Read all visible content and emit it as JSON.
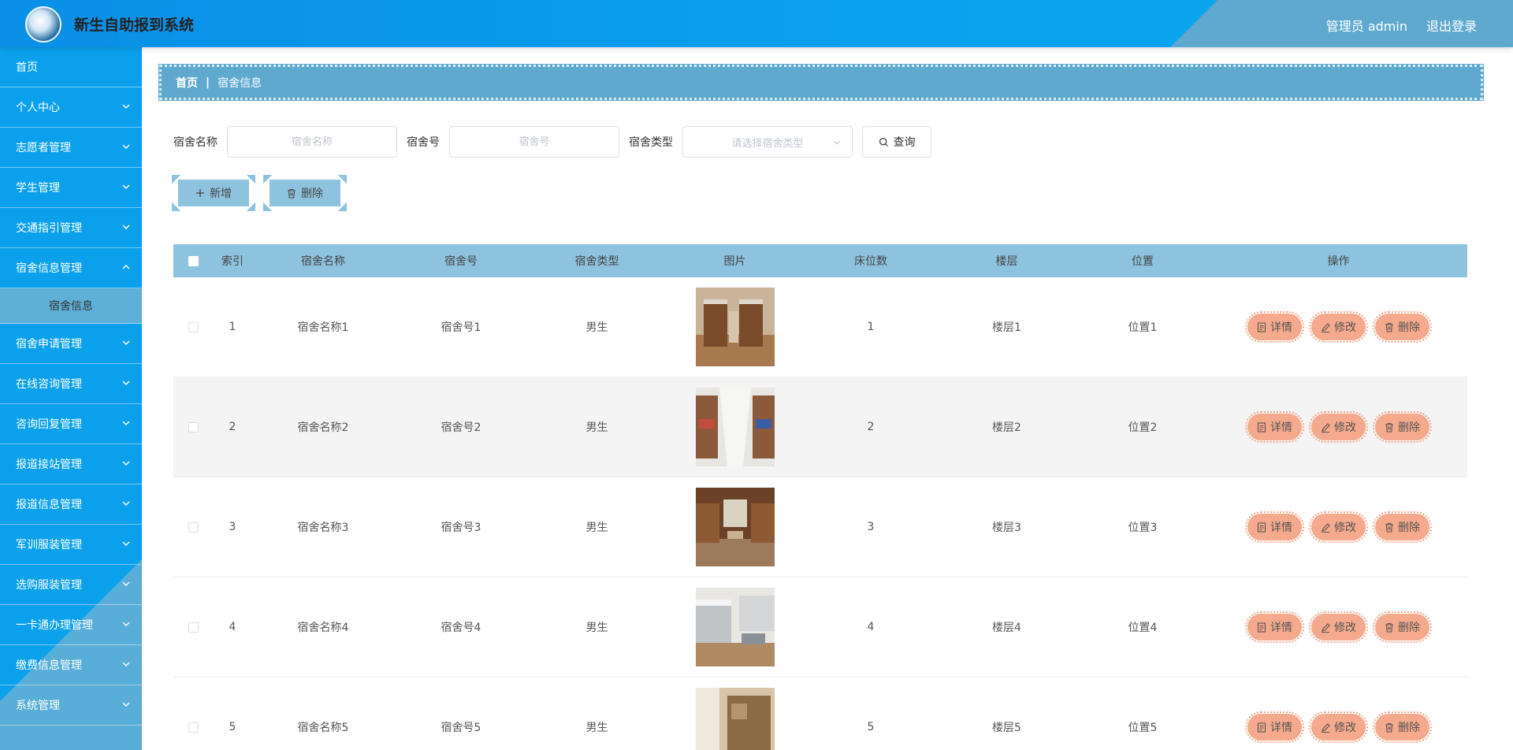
{
  "header": {
    "title": "新生自助报到系统",
    "admin_label": "管理员 admin",
    "logout_label": "退出登录"
  },
  "sidebar": {
    "items": [
      {
        "label": "首页"
      },
      {
        "label": "个人中心"
      },
      {
        "label": "志愿者管理"
      },
      {
        "label": "学生管理"
      },
      {
        "label": "交通指引管理"
      },
      {
        "label": "宿舍信息管理"
      },
      {
        "label": "宿舍信息"
      },
      {
        "label": "宿舍申请管理"
      },
      {
        "label": "在线咨询管理"
      },
      {
        "label": "咨询回复管理"
      },
      {
        "label": "报道接站管理"
      },
      {
        "label": "报道信息管理"
      },
      {
        "label": "军训服装管理"
      },
      {
        "label": "选购服装管理"
      },
      {
        "label": "一卡通办理管理"
      },
      {
        "label": "缴费信息管理"
      },
      {
        "label": "系统管理"
      }
    ]
  },
  "breadcrumb": {
    "home": "首页",
    "current": "宿舍信息"
  },
  "search": {
    "name_label": "宿舍名称",
    "name_placeholder": "宿舍名称",
    "no_label": "宿舍号",
    "no_placeholder": "宿舍号",
    "type_label": "宿舍类型",
    "type_placeholder": "请选择宿舍类型",
    "query_label": "查询"
  },
  "actions": {
    "add_label": "新增",
    "delete_label": "删除"
  },
  "table": {
    "headers": [
      "索引",
      "宿舍名称",
      "宿舍号",
      "宿舍类型",
      "图片",
      "床位数",
      "楼层",
      "位置",
      "操作"
    ],
    "rows": [
      {
        "idx": "1",
        "name": "宿舍名称1",
        "no": "宿舍号1",
        "type": "男生",
        "bed": "1",
        "floor": "楼层1",
        "pos": "位置1"
      },
      {
        "idx": "2",
        "name": "宿舍名称2",
        "no": "宿舍号2",
        "type": "男生",
        "bed": "2",
        "floor": "楼层2",
        "pos": "位置2"
      },
      {
        "idx": "3",
        "name": "宿舍名称3",
        "no": "宿舍号3",
        "type": "男生",
        "bed": "3",
        "floor": "楼层3",
        "pos": "位置3"
      },
      {
        "idx": "4",
        "name": "宿舍名称4",
        "no": "宿舍号4",
        "type": "男生",
        "bed": "4",
        "floor": "楼层4",
        "pos": "位置4"
      },
      {
        "idx": "5",
        "name": "宿舍名称5",
        "no": "宿舍号5",
        "type": "男生",
        "bed": "5",
        "floor": "楼层5",
        "pos": "位置5"
      }
    ],
    "op": {
      "detail": "详情",
      "edit": "修改",
      "delete": "删除"
    }
  },
  "colors": {
    "header_bg": "#0a9be9",
    "table_head": "#8ec3df",
    "op_button": "#f5a98d"
  }
}
